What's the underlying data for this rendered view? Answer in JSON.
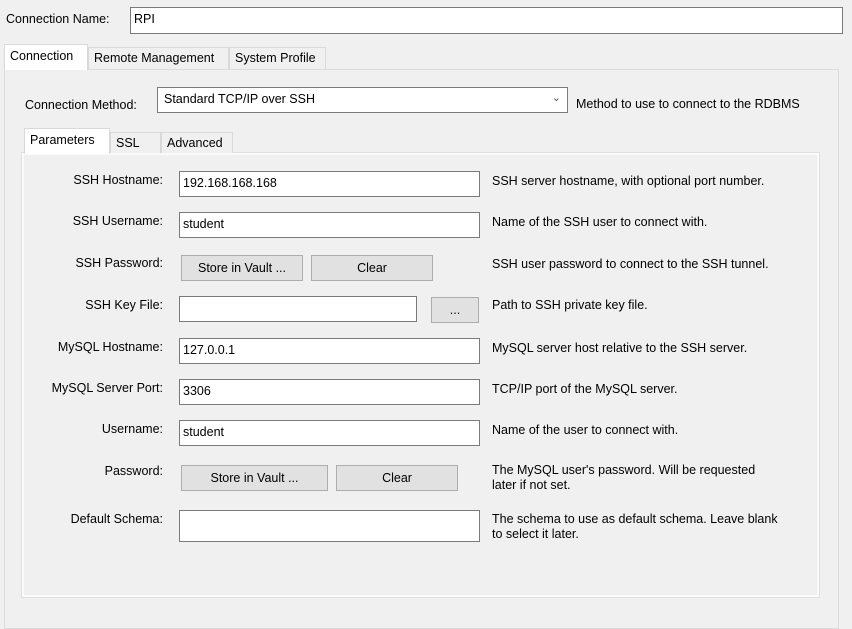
{
  "connection_name": {
    "label": "Connection Name:",
    "value": "RPI"
  },
  "main_tabs": [
    {
      "label": "Connection",
      "active": true
    },
    {
      "label": "Remote Management"
    },
    {
      "label": "System Profile"
    }
  ],
  "connection_method": {
    "label": "Connection Method:",
    "value": "Standard TCP/IP over SSH",
    "description": "Method to use to connect to the RDBMS"
  },
  "sub_tabs": [
    {
      "label": "Parameters",
      "active": true
    },
    {
      "label": "SSL"
    },
    {
      "label": "Advanced"
    }
  ],
  "fields": {
    "ssh_hostname": {
      "label": "SSH Hostname:",
      "value": "192.168.168.168",
      "description": "SSH server hostname, with  optional port number."
    },
    "ssh_username": {
      "label": "SSH Username:",
      "value": "student",
      "description": "Name of the SSH user to connect with."
    },
    "ssh_password": {
      "label": "SSH Password:",
      "store": "Store in Vault ...",
      "clear": "Clear",
      "description": "SSH user password to connect to the SSH tunnel."
    },
    "ssh_key_file": {
      "label": "SSH Key File:",
      "value": "",
      "browse": "...",
      "description": "Path to SSH private key file."
    },
    "mysql_hostname": {
      "label": "MySQL Hostname:",
      "value": "127.0.0.1",
      "description": "MySQL server host relative to the SSH server."
    },
    "mysql_port": {
      "label": "MySQL Server Port:",
      "value": "3306",
      "description": "TCP/IP port of the MySQL server."
    },
    "username": {
      "label": "Username:",
      "value": "student",
      "description": "Name of the user to connect with."
    },
    "password": {
      "label": "Password:",
      "store": "Store in Vault ...",
      "clear": "Clear",
      "description": "The MySQL user's password. Will be requested later if not set."
    },
    "default_schema": {
      "label": "Default Schema:",
      "value": "",
      "description": "The schema to use as default schema. Leave blank to select it later."
    }
  }
}
